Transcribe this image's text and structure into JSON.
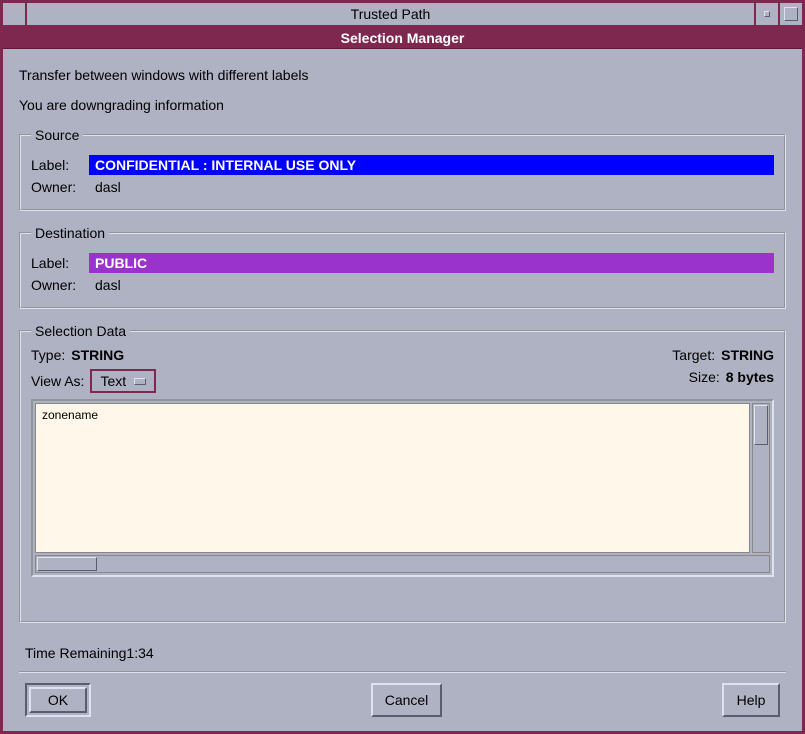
{
  "window": {
    "title": "Trusted Path",
    "subtitle": "Selection Manager"
  },
  "messages": {
    "line1": "Transfer between windows with different labels",
    "line2": "You are downgrading information"
  },
  "source": {
    "legend": "Source",
    "label_key": "Label:",
    "label_value": "CONFIDENTIAL : INTERNAL USE ONLY",
    "owner_key": "Owner:",
    "owner_value": "dasl"
  },
  "destination": {
    "legend": "Destination",
    "label_key": "Label:",
    "label_value": "PUBLIC",
    "owner_key": "Owner:",
    "owner_value": "dasl"
  },
  "selection": {
    "legend": "Selection Data",
    "type_key": "Type:",
    "type_value": "STRING",
    "viewas_key": "View As:",
    "viewas_value": "Text",
    "target_key": "Target:",
    "target_value": "STRING",
    "size_key": "Size:",
    "size_value": "8 bytes",
    "content": "zonename"
  },
  "timer": {
    "label": "Time Remaining",
    "value": "1:34"
  },
  "buttons": {
    "ok": "OK",
    "cancel": "Cancel",
    "help": "Help"
  }
}
